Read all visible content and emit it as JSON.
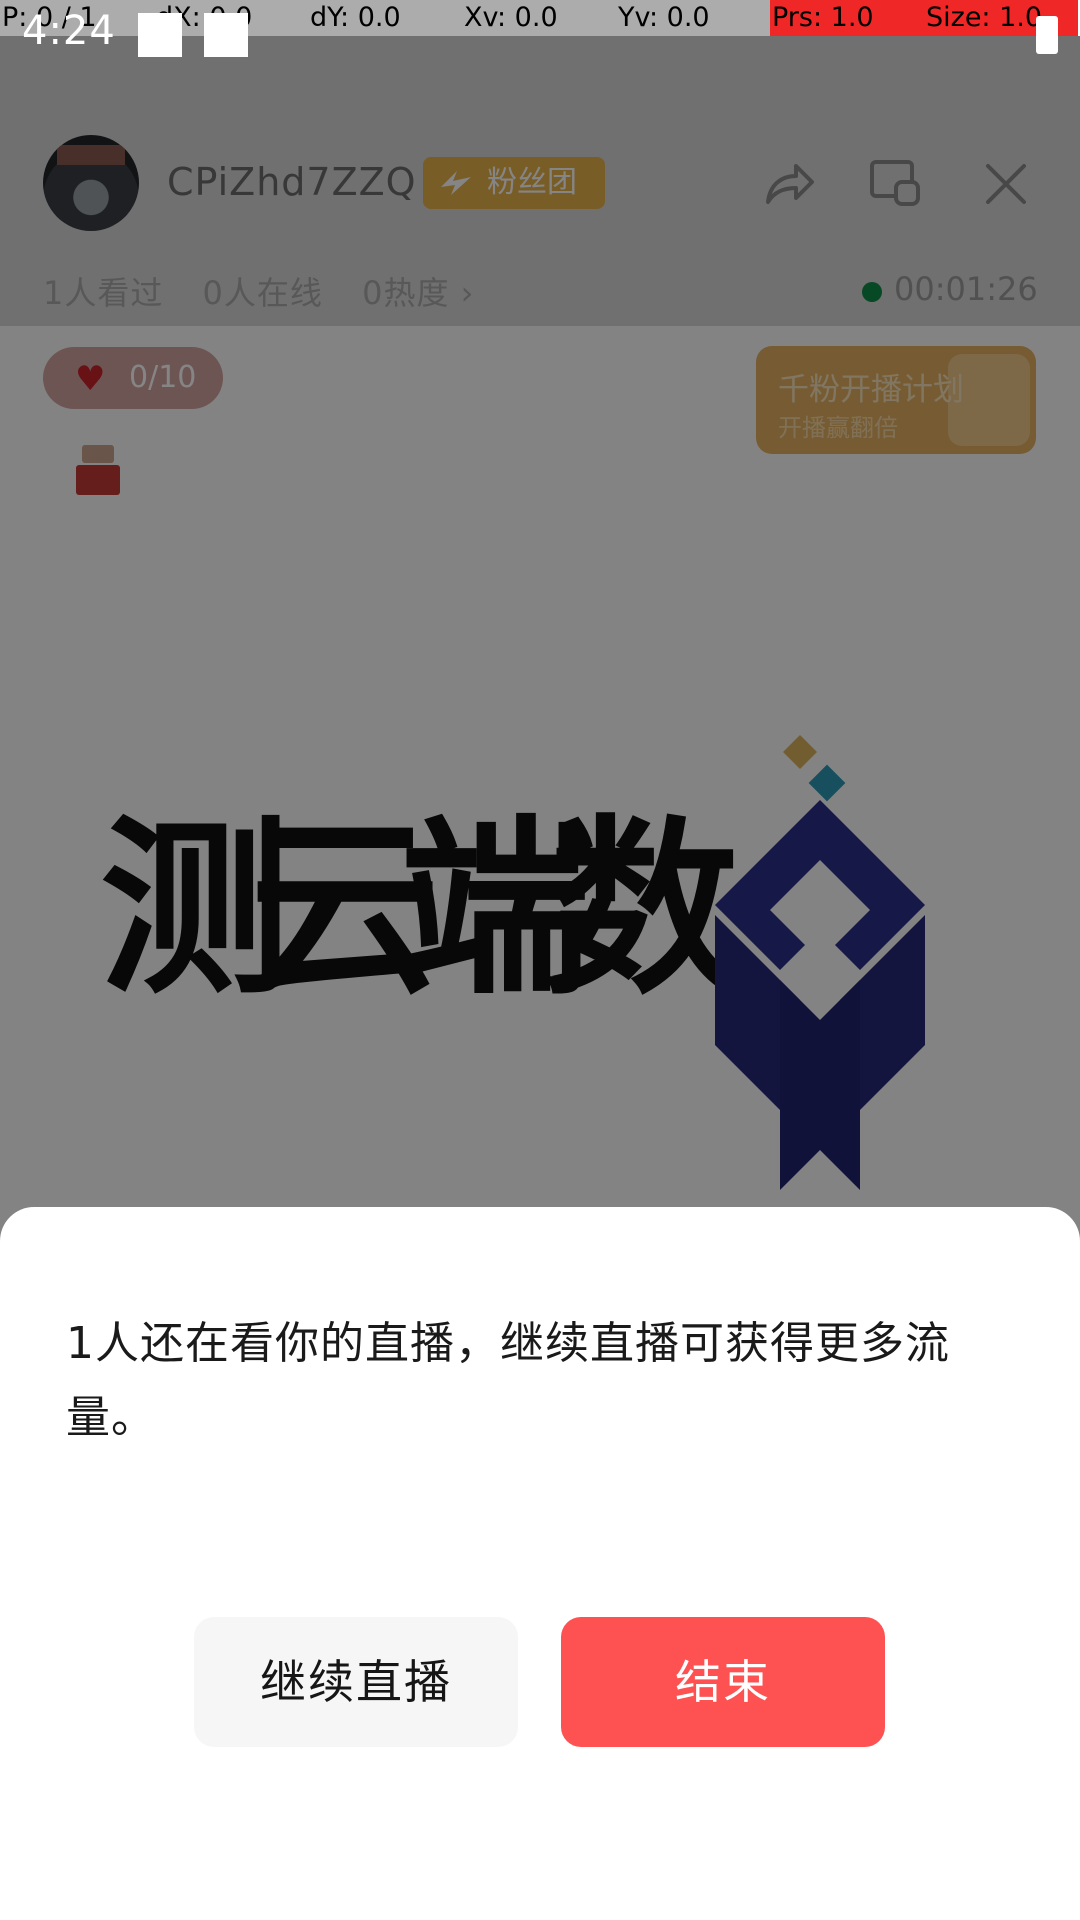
{
  "debug_bar": {
    "cells": [
      {
        "text": "P: 0 / 1",
        "red": false
      },
      {
        "text": "dX: 0.0",
        "red": false
      },
      {
        "text": "dY: 0.0",
        "red": false
      },
      {
        "text": "Xv: 0.0",
        "red": false
      },
      {
        "text": "Yv: 0.0",
        "red": false
      },
      {
        "text": "Prs: 1.0",
        "red": true
      },
      {
        "text": "Size: 1.0",
        "red": true
      }
    ]
  },
  "status_bar": {
    "time": "4:24"
  },
  "live_room": {
    "host_name": "CPiZhd7ZZQ",
    "fans_badge": "粉丝团",
    "stats": [
      "1人看过",
      "0人在线",
      "0热度 ›"
    ],
    "live_timer": "00:01:26",
    "likes": {
      "count": "0",
      "total": "/10"
    },
    "promo": {
      "title": "千粉开播计划",
      "subtitle": "开播赢翻倍"
    },
    "logo_text": [
      "测",
      "云",
      "端",
      "数"
    ],
    "icons": [
      "share-icon",
      "screen-cast-icon",
      "close-icon",
      "gift-icon",
      "heart-icon"
    ]
  },
  "dialog": {
    "message": "1人还在看你的直播，继续直播可获得更多流量。",
    "continue_label": "继续直播",
    "end_label": "结束",
    "colors": {
      "end_button": "#fe5252",
      "continue_button": "#f6f6f6"
    }
  }
}
